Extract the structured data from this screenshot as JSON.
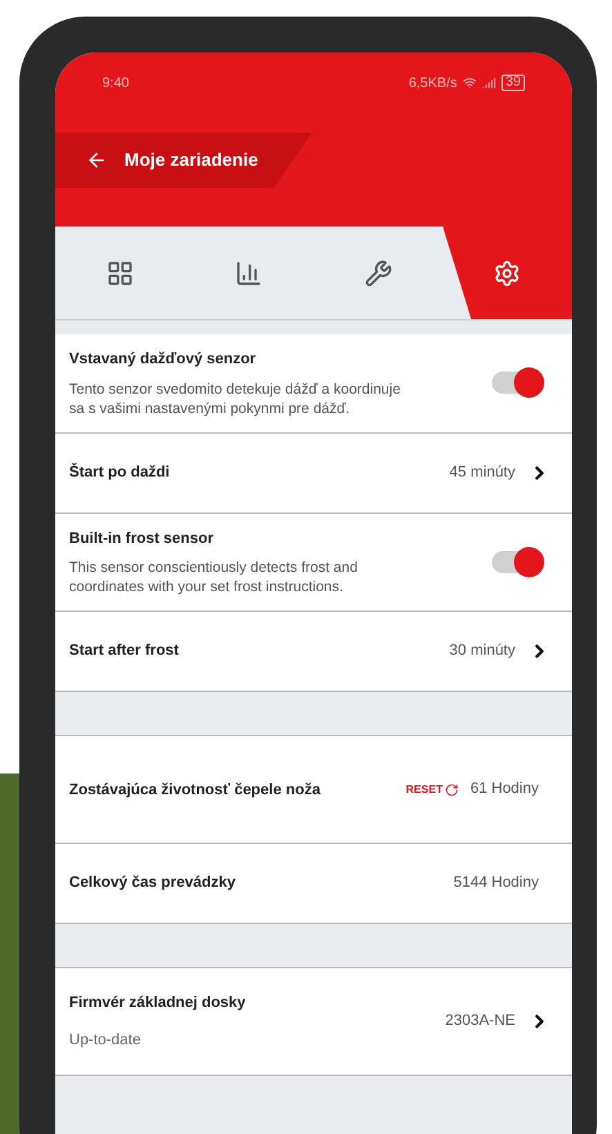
{
  "status_bar": {
    "time": "9:40",
    "network_speed": "6,5KB/s",
    "battery": "39"
  },
  "header": {
    "title": "Moje zariadenie"
  },
  "tabs": [
    {
      "kind": "grid",
      "selected": false
    },
    {
      "kind": "chart",
      "selected": false
    },
    {
      "kind": "wrench",
      "selected": false
    },
    {
      "kind": "gear",
      "selected": true
    }
  ],
  "rows": [
    {
      "kind": "toggle",
      "title": "Vstavaný dažďový senzor",
      "description": "Tento senzor svedomito detekuje dážď a koordinuje sa s vašimi nastavenými pokynmi pre dážď.",
      "on": true
    },
    {
      "kind": "nav",
      "title": "Štart po daždi",
      "value": "45 minúty"
    },
    {
      "kind": "toggle",
      "title": "Built-in frost sensor",
      "description": "This sensor conscientiously detects frost and coordinates with your set frost instructions.",
      "on": true
    },
    {
      "kind": "nav",
      "title": "Start after frost",
      "value": "30 minúty"
    },
    {
      "kind": "spacer"
    },
    {
      "kind": "reset",
      "title": "Zostávajúca životnosť čepele noža",
      "action": "RESET",
      "value": "61 Hodiny"
    },
    {
      "kind": "value",
      "title": "Celkový čas prevádzky",
      "value": "5144 Hodiny"
    },
    {
      "kind": "spacer"
    },
    {
      "kind": "nav",
      "title": "Firmvér základnej dosky",
      "subtitle": "Up-to-date",
      "value": "2303A-NE"
    }
  ]
}
